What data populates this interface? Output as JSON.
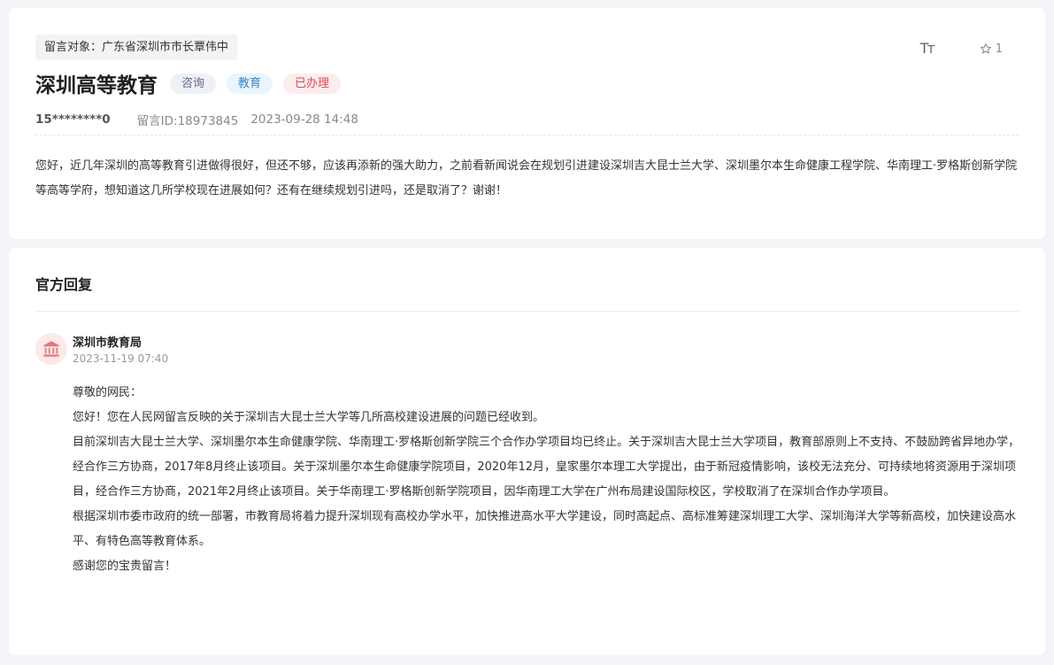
{
  "message": {
    "target": "留言对象：广东省深圳市市长覃伟中",
    "title": "深圳高等教育",
    "tags": [
      {
        "label": "咨询",
        "color": "#5b6b84"
      },
      {
        "label": "教育",
        "color": "#3b86c6"
      },
      {
        "label": "已办理",
        "color": "#e04a54"
      }
    ],
    "font_tool_label": "Tт",
    "favorite_count": "1",
    "user": "15********0",
    "message_id": "留言ID:18973845",
    "datetime": "2023-09-28 14:48",
    "content": "您好，近几年深圳的高等教育引进做得很好，但还不够，应该再添新的强大助力，之前看新闻说会在规划引进建设深圳吉大昆士兰大学、深圳墨尔本生命健康工程学院、华南理工·罗格斯创新学院等高等学府，想知道这几所学校现在进展如何？还有在继续规划引进吗，还是取消了？谢谢！"
  },
  "reply": {
    "heading": "官方回复",
    "org_name": "深圳市教育局",
    "org_icon": "government-building-icon",
    "datetime": "2023-11-19 07:40",
    "paragraphs": [
      "尊敬的网民：",
      "您好！您在人民网留言反映的关于深圳吉大昆士兰大学等几所高校建设进展的问题已经收到。",
      "目前深圳吉大昆士兰大学、深圳墨尔本生命健康学院、华南理工·罗格斯创新学院三个合作办学项目均已终止。关于深圳吉大昆士兰大学项目，教育部原则上不支持、不鼓励跨省异地办学，经合作三方协商，2017年8月终止该项目。关于深圳墨尔本生命健康学院项目，2020年12月，皇家墨尔本理工大学提出，由于新冠疫情影响，该校无法充分、可持续地将资源用于深圳项目，经合作三方协商，2021年2月终止该项目。关于华南理工·罗格斯创新学院项目，因华南理工大学在广州布局建设国际校区，学校取消了在深圳合作办学项目。",
      "根据深圳市委市政府的统一部署，市教育局将着力提升深圳现有高校办学水平，加快推进高水平大学建设，同时高起点、高标准筹建深圳理工大学、深圳海洋大学等新高校，加快建设高水平、有特色高等教育体系。",
      "感谢您的宝贵留言！"
    ]
  },
  "colors": {
    "page_background": "#f3f4f7",
    "card_background": "#ffffff",
    "accent_red": "#e04a54"
  }
}
